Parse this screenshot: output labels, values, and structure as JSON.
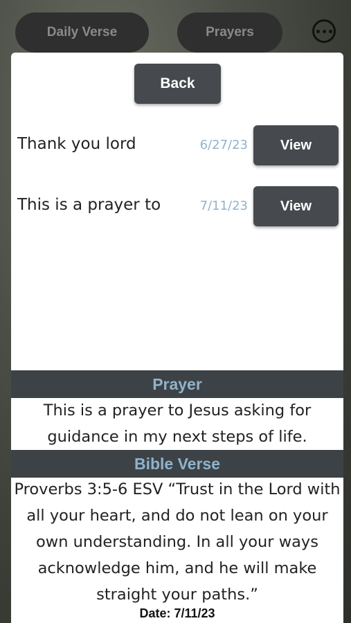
{
  "nav": {
    "tabs": [
      "Daily Verse",
      "Prayers"
    ],
    "more_icon": "more-horizontal-icon"
  },
  "list": {
    "back_label": "Back",
    "items": [
      {
        "title": "Thank you lord",
        "date": "6/27/23",
        "action": "View"
      },
      {
        "title": "This is a prayer to",
        "date": "7/11/23",
        "action": "View"
      }
    ]
  },
  "detail": {
    "prayer_heading": "Prayer",
    "prayer_text": "This is a prayer to Jesus asking for guidance in my next steps of life.",
    "verse_heading": "Bible Verse",
    "verse_text": "Proverbs 3:5-6 ESV “Trust in the Lord with all your heart, and do not lean on your own understanding. In all your ways acknowledge him, and he will make straight your paths.”",
    "date_line": "Date: 7/11/23"
  },
  "colors": {
    "accent": "#8fb3cc",
    "button": "#464a4e",
    "section_bg": "#3d4246"
  }
}
